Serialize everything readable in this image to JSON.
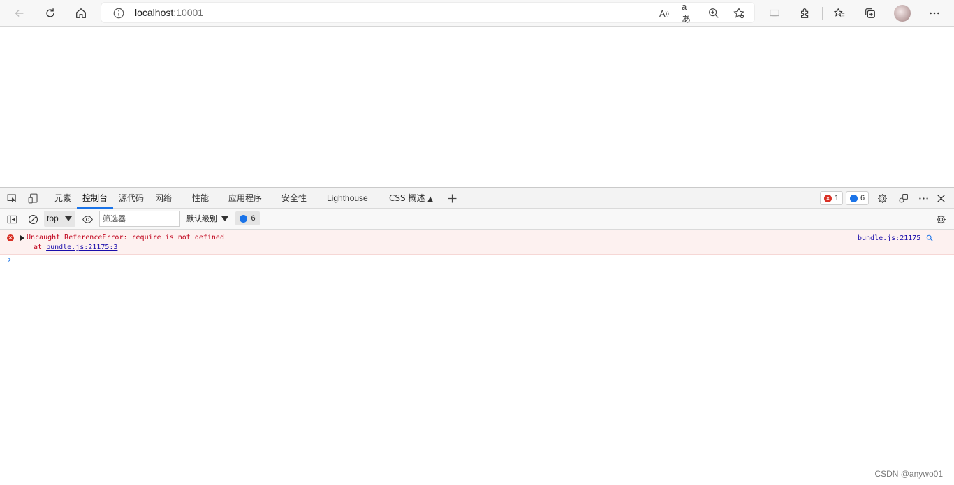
{
  "browser": {
    "url_host": "localhost",
    "url_port": ":10001",
    "read_aloud_icon_text": "A",
    "translate_icon_text": "aあ"
  },
  "devtools": {
    "tabs": [
      {
        "label": "元素"
      },
      {
        "label": "控制台"
      },
      {
        "label": "源代码"
      },
      {
        "label": "网络"
      },
      {
        "label": "性能"
      },
      {
        "label": "应用程序"
      },
      {
        "label": "安全性"
      },
      {
        "label": "Lighthouse"
      },
      {
        "label": "CSS 概述"
      }
    ],
    "error_count": "1",
    "message_count": "6"
  },
  "console_toolbar": {
    "context": "top",
    "filter_placeholder": "筛选器",
    "levels": "默认级别",
    "message_count": "6"
  },
  "console": {
    "error_message": "Uncaught ReferenceError: require is not defined",
    "error_at_prefix": "at ",
    "error_at_link": "bundle.js:21175:3",
    "error_source": "bundle.js:21175",
    "prompt": "›"
  },
  "watermark": "CSDN @anywo01",
  "colors": {
    "accent": "#1a73e8",
    "error": "#d93025",
    "error_bg": "#fdf1f0"
  }
}
